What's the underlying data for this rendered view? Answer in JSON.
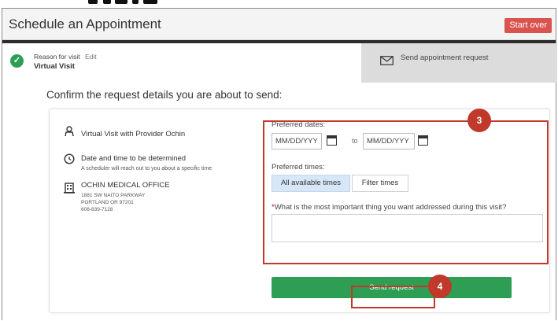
{
  "header": {
    "title": "Schedule an Appointment",
    "start_over": "Start over"
  },
  "steps": {
    "reason_label": "Reason for visit",
    "edit": "Edit",
    "reason_value": "Virtual Visit",
    "send_step": "Send appointment request"
  },
  "confirm_heading": "Confirm the request details you are about to send:",
  "details": {
    "visit_with": "Virtual Visit with Provider Ochin",
    "date_time": "Date and time to be determined",
    "date_time_sub": "A scheduler will reach out to you about a specific time",
    "office_name": "OCHIN MEDICAL OFFICE",
    "address1": "1881 SW NAITO PARKWAY",
    "address2": "PORTLAND OR 97201",
    "phone": "608-839-7128"
  },
  "form": {
    "preferred_dates": "Preferred dates:",
    "from_placeholder": "MM/DD/YYY",
    "to": "to",
    "to_placeholder": "MM/DD/YYY",
    "preferred_times": "Preferred times:",
    "all_times": "All available times",
    "filter_times": "Filter times",
    "required_mark": "*",
    "question": "What is the most important thing you want addressed during this visit?",
    "send": "Send request"
  },
  "annotations": {
    "badge_3": "3",
    "badge_4": "4"
  },
  "colors": {
    "accent_green": "#2e9e55",
    "start_over_red": "#d9534f",
    "annotation_red": "#c0392b",
    "selected_time_bg": "#d7e7f7"
  },
  "icons": [
    "check-circle-icon",
    "envelope-icon",
    "provider-icon",
    "clock-icon",
    "building-icon",
    "calendar-icon"
  ]
}
